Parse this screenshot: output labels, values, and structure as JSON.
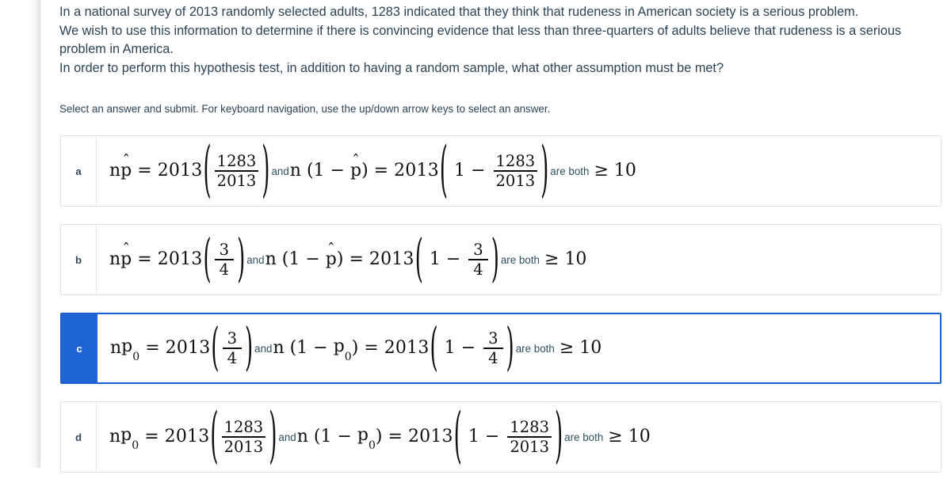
{
  "question": {
    "lines": [
      "In a national survey of 2013 randomly selected adults, 1283 indicated that they think that rudeness in American society is a serious problem.",
      "We wish to use this information to determine if there is convincing evidence that less than three-quarters of adults believe that rudeness is a serious problem in America.",
      "In order to perform this hypothesis test, in addition to having a random sample, what other assumption must be met?"
    ],
    "instruction": "Select an answer and submit. For keyboard navigation, use the up/down arrow keys to select an answer."
  },
  "colors": {
    "selected_blue": "#1f64d4",
    "border_gray": "#dfe2e5",
    "text_slate": "#2d4457"
  },
  "options": [
    {
      "letter": "a",
      "selected": false,
      "lhs_symbol": "np̂",
      "n": "2013",
      "frac_num": "1283",
      "frac_den": "2013",
      "connective_and": "and",
      "rhs_symbol": "n (1 − p̂)",
      "rhs_n": "2013",
      "rhs_one": "1",
      "rhs_frac_num": "1283",
      "rhs_frac_den": "2013",
      "connective_tail": "are both",
      "geq": "≥",
      "threshold": "10",
      "param_style": "phat",
      "frac_style": "stacked"
    },
    {
      "letter": "b",
      "selected": false,
      "lhs_symbol": "np̂",
      "n": "2013",
      "frac_num": "3",
      "frac_den": "4",
      "connective_and": "and",
      "rhs_symbol": "n (1 − p̂)",
      "rhs_n": "2013",
      "rhs_one": "1",
      "rhs_frac_num": "3",
      "rhs_frac_den": "4",
      "connective_tail": "are both",
      "geq": "≥",
      "threshold": "10",
      "param_style": "phat",
      "frac_style": "stacked"
    },
    {
      "letter": "c",
      "selected": true,
      "lhs_symbol": "np₀",
      "n": "2013",
      "frac_num": "3",
      "frac_den": "4",
      "connective_and": "and",
      "rhs_symbol": "n (1 − p₀)",
      "rhs_n": "2013",
      "rhs_one": "1",
      "rhs_frac_num": "3",
      "rhs_frac_den": "4",
      "connective_tail": "are both",
      "geq": "≥",
      "threshold": "10",
      "param_style": "pnought",
      "frac_style": "stacked"
    },
    {
      "letter": "d",
      "selected": false,
      "lhs_symbol": "np₀",
      "n": "2013",
      "frac_num": "1283",
      "frac_den": "2013",
      "connective_and": "and",
      "rhs_symbol": "n (1 − p₀)",
      "rhs_n": "2013",
      "rhs_one": "1",
      "rhs_frac_num": "1283",
      "rhs_frac_den": "2013",
      "connective_tail": "are both",
      "geq": "≥",
      "threshold": "10",
      "param_style": "pnought",
      "frac_style": "stacked"
    }
  ],
  "math_tokens": {
    "equals": "=",
    "minus": "−",
    "lparen": "(",
    "rparen": ")",
    "n_letter": "n",
    "p_letter": "p",
    "hat": "ˆ",
    "zero_sub": "0"
  }
}
